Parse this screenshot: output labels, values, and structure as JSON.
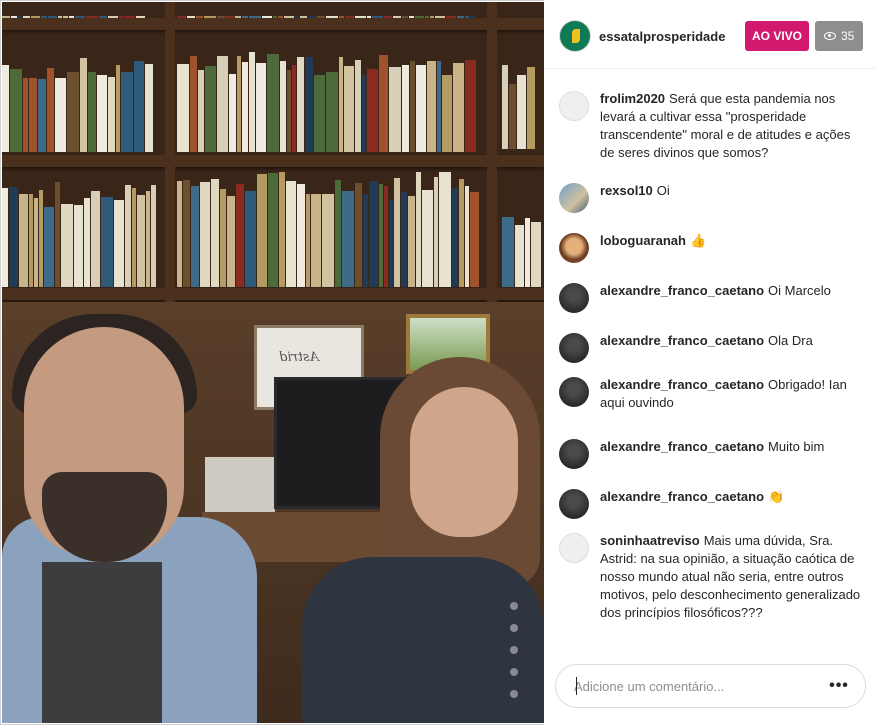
{
  "channel": {
    "name": "essatalprosperidade",
    "live_label": "AO VIVO",
    "viewers": "35",
    "avatar_icon": "leaf-logo-icon"
  },
  "comments": [
    {
      "user": "frolim2020",
      "text": "Será que esta pandemia nos levará a cultivar essa \"prosperidade transcendente\" moral e de atitudes e ações de seres divinos que somos?",
      "avatar": "empty"
    },
    {
      "user": "rexsol10",
      "text": "Oi",
      "avatar": "rex"
    },
    {
      "user": "loboguaranah",
      "text": "👍",
      "avatar": "lobo"
    },
    {
      "user": "alexandre_franco_caetano",
      "text": "Oi Marcelo",
      "avatar": "alex"
    },
    {
      "user": "alexandre_franco_caetano",
      "text": "Ola Dra",
      "avatar": "alex"
    },
    {
      "user": "alexandre_franco_caetano",
      "text": "Obrigado! Ian aqui ouvindo",
      "avatar": "alex"
    },
    {
      "user": "alexandre_franco_caetano",
      "text": "Muito bim",
      "avatar": "alex"
    },
    {
      "user": "alexandre_franco_caetano",
      "text": "👏",
      "avatar": "alex"
    },
    {
      "user": "soninhaatreviso",
      "text": "Mais uma dúvida, Sra. Astrid: na sua opinião, a situação caótica de nosso mundo atual não seria, entre outros motivos, pelo desconhecimento generalizado dos princípios filosóficos???",
      "avatar": "empty"
    }
  ],
  "comment_box": {
    "placeholder": "Adicione um comentário...",
    "more_label": "•••"
  },
  "video": {
    "frame_text": "Astrid"
  }
}
